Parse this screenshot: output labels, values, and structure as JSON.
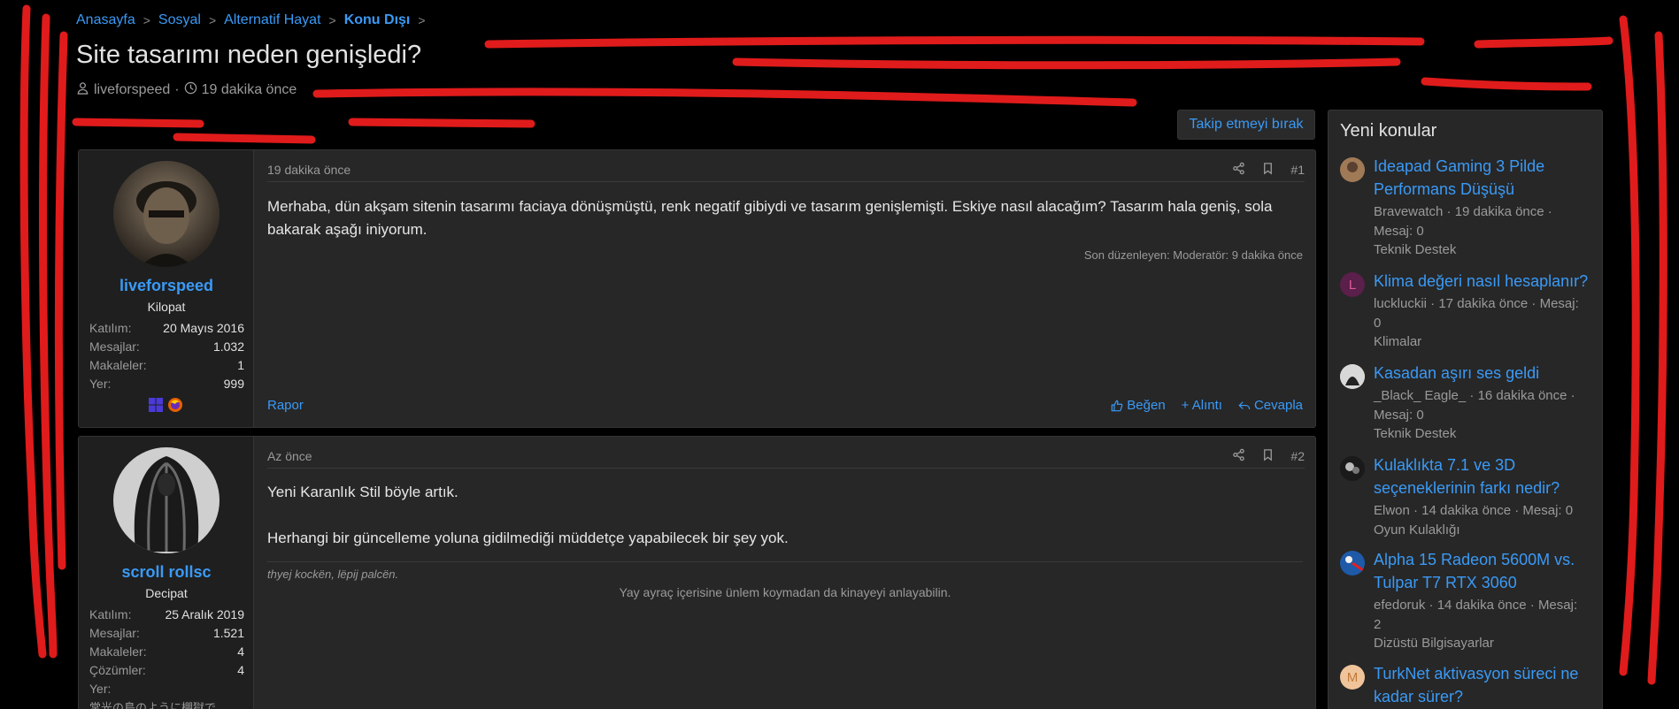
{
  "breadcrumb": [
    {
      "label": "Anasayfa"
    },
    {
      "label": "Sosyal"
    },
    {
      "label": "Alternatif Hayat"
    },
    {
      "label": "Konu Dışı"
    }
  ],
  "thread": {
    "title": "Site tasarımı neden genişledi?",
    "author": "liveforspeed",
    "time": "19 dakika önce",
    "follow_label": "Takip etmeyi bırak"
  },
  "posts": [
    {
      "time": "19 dakika önce",
      "number": "#1",
      "username": "liveforspeed",
      "usertitle": "Kilopat",
      "stats": [
        {
          "k": "Katılım:",
          "v": "20 Mayıs 2016"
        },
        {
          "k": "Mesajlar:",
          "v": "1.032"
        },
        {
          "k": "Makaleler:",
          "v": "1"
        },
        {
          "k": "Yer:",
          "v": "999"
        }
      ],
      "text": "Merhaba, dün akşam sitenin tasarımı faciaya dönüşmüştü, renk negatif gibiydi ve tasarım genişlemişti. Eskiye nasıl alacağım? Tasarım hala geniş, sola bakarak aşağı iniyorum.",
      "edited": "Son düzenleyen: Moderatör: 9 dakika önce",
      "report": "Rapor",
      "like": "Beğen",
      "quote": "+ Alıntı",
      "reply": "Cevapla"
    },
    {
      "time": "Az önce",
      "number": "#2",
      "username": "scroll rollsc",
      "usertitle": "Decipat",
      "stats": [
        {
          "k": "Katılım:",
          "v": "25 Aralık 2019"
        },
        {
          "k": "Mesajlar:",
          "v": "1.521"
        },
        {
          "k": "Makaleler:",
          "v": "4"
        },
        {
          "k": "Çözümler:",
          "v": "4"
        },
        {
          "k": "Yer:",
          "v": ""
        }
      ],
      "user_extra": "常光の島のように棚獄で",
      "text1": "Yeni Karanlık Stil böyle artık.",
      "text2": "Herhangi bir güncelleme yoluna gidilmediği müddetçe yapabilecek bir şey yok.",
      "sig_italic": "thyej kockën, lëpij palcën.",
      "sig_center": "Yay ayraç içerisine ünlem koymadan da kinayeyi anlayabilin."
    }
  ],
  "sidebar": {
    "title": "Yeni konular",
    "threads": [
      {
        "title": "Ideapad Gaming 3 Pilde Performans Düşüşü",
        "meta": "Bravewatch · 19 dakika önce · Mesaj: 0",
        "forum": "Teknik Destek",
        "avatar_letter": ""
      },
      {
        "title": "Klima değeri nasıl hesaplanır?",
        "meta": "luckluckii · 17 dakika önce · Mesaj: 0",
        "forum": "Klimalar",
        "avatar_letter": "L"
      },
      {
        "title": "Kasadan aşırı ses geldi",
        "meta": "_Black_ Eagle_ · 16 dakika önce · Mesaj: 0",
        "forum": "Teknik Destek",
        "avatar_letter": ""
      },
      {
        "title": "Kulaklıkta 7.1 ve 3D seçeneklerinin farkı nedir?",
        "meta": "Elwon · 14 dakika önce · Mesaj: 0",
        "forum": "Oyun Kulaklığı",
        "avatar_letter": ""
      },
      {
        "title": "Alpha 15 Radeon 5600M vs. Tulpar T7 RTX 3060",
        "meta": "efedoruk · 14 dakika önce · Mesaj: 2",
        "forum": "Dizüstü Bilgisayarlar",
        "avatar_letter": ""
      },
      {
        "title": "TurkNet aktivasyon süreci ne kadar sürer?",
        "meta": "",
        "forum": "",
        "avatar_letter": "M"
      }
    ]
  },
  "colors": {
    "accent": "#3a9af6",
    "background": "#000000",
    "panel": "#272727",
    "annotation": "#e01b1b"
  }
}
